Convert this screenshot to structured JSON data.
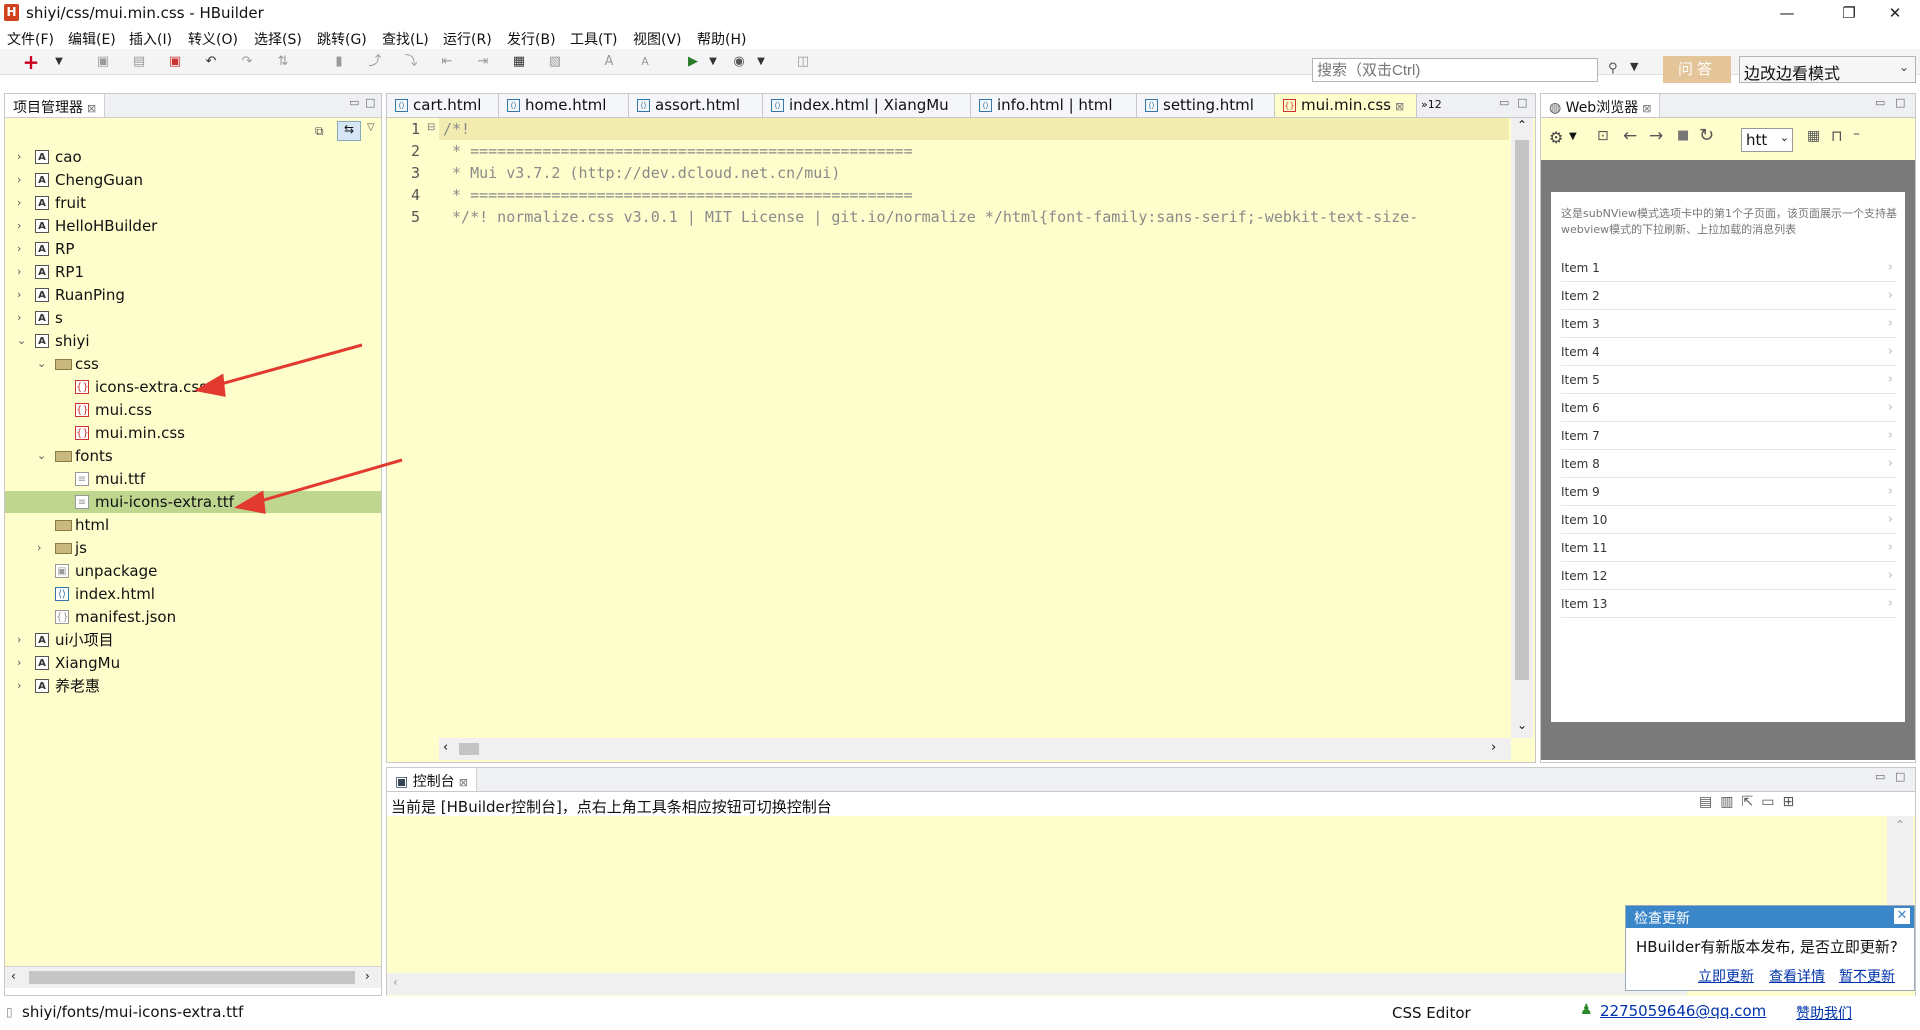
{
  "window": {
    "title": "shiyi/css/mui.min.css  -  HBuilder",
    "logo": "H"
  },
  "menu": [
    "文件(F)",
    "编辑(E)",
    "插入(I)",
    "转义(O)",
    "选择(S)",
    "跳转(G)",
    "查找(L)",
    "运行(R)",
    "发行(B)",
    "工具(T)",
    "视图(V)",
    "帮助(H)"
  ],
  "toolbar": {
    "search_placeholder": "搜索（双击Ctrl)",
    "ask_label": "问答",
    "mode_label": "边改边看模式"
  },
  "project": {
    "title": "项目管理器",
    "tree": [
      {
        "label": "cao",
        "depth": 0,
        "icon": "project-icon",
        "twisty": "›"
      },
      {
        "label": "ChengGuan",
        "depth": 0,
        "icon": "project-icon",
        "twisty": "›"
      },
      {
        "label": "fruit",
        "depth": 0,
        "icon": "project-icon",
        "twisty": "›"
      },
      {
        "label": "HelloHBuilder",
        "depth": 0,
        "icon": "project-icon",
        "twisty": "›"
      },
      {
        "label": "RP",
        "depth": 0,
        "icon": "project-icon",
        "twisty": "›"
      },
      {
        "label": "RP1",
        "depth": 0,
        "icon": "project-icon",
        "twisty": "›"
      },
      {
        "label": "RuanPing",
        "depth": 0,
        "icon": "project-icon",
        "twisty": "›"
      },
      {
        "label": "s",
        "depth": 0,
        "icon": "project-icon",
        "twisty": "›"
      },
      {
        "label": "shiyi",
        "depth": 0,
        "icon": "project-icon",
        "twisty": "⌄"
      },
      {
        "label": "css",
        "depth": 1,
        "icon": "folder-icon",
        "twisty": "⌄"
      },
      {
        "label": "icons-extra.css",
        "depth": 2,
        "icon": "css-file-icon",
        "twisty": ""
      },
      {
        "label": "mui.css",
        "depth": 2,
        "icon": "css-file-icon",
        "twisty": ""
      },
      {
        "label": "mui.min.css",
        "depth": 2,
        "icon": "css-file-icon",
        "twisty": ""
      },
      {
        "label": "fonts",
        "depth": 1,
        "icon": "folder-icon",
        "twisty": "⌄"
      },
      {
        "label": "mui.ttf",
        "depth": 2,
        "icon": "file-icon",
        "twisty": ""
      },
      {
        "label": "mui-icons-extra.ttf",
        "depth": 2,
        "icon": "file-icon",
        "twisty": "",
        "selected": true
      },
      {
        "label": "html",
        "depth": 1,
        "icon": "folder-icon",
        "twisty": ""
      },
      {
        "label": "js",
        "depth": 1,
        "icon": "folder-icon",
        "twisty": "›"
      },
      {
        "label": "unpackage",
        "depth": 1,
        "icon": "package-icon",
        "twisty": ""
      },
      {
        "label": "index.html",
        "depth": 1,
        "icon": "html-file-icon",
        "twisty": ""
      },
      {
        "label": "manifest.json",
        "depth": 1,
        "icon": "json-file-icon",
        "twisty": ""
      },
      {
        "label": "ui小项目",
        "depth": 0,
        "icon": "project-icon",
        "twisty": "›"
      },
      {
        "label": "XiangMu",
        "depth": 0,
        "icon": "project-icon",
        "twisty": "›"
      },
      {
        "label": "养老惠",
        "depth": 0,
        "icon": "project-icon",
        "twisty": "›"
      }
    ]
  },
  "editor": {
    "tabs": [
      "cart.html",
      "home.html",
      "assort.html",
      "index.html | XiangMu",
      "info.html | html",
      "setting.html",
      "mui.min.css"
    ],
    "overflow": "»12",
    "line_numbers": [
      "1",
      "2",
      "3",
      "4",
      "5"
    ],
    "lines": [
      "/*!",
      " * =================================================",
      " * Mui v3.7.2 (http://dev.dcloud.net.cn/mui)",
      " * =================================================",
      " */*! normalize.css v3.0.1 | MIT License | git.io/normalize */html{font-family:sans-serif;-webkit-text-size-"
    ]
  },
  "browser": {
    "title": "Web浏览器",
    "address": "htt",
    "intro": "这是subNView模式选项卡中的第1个子页面，该页面展示一个支持基webview模式的下拉刷新、上拉加载的消息列表",
    "items": [
      "Item 1",
      "Item 2",
      "Item 3",
      "Item 4",
      "Item 5",
      "Item 6",
      "Item 7",
      "Item 8",
      "Item 9",
      "Item 10",
      "Item 11",
      "Item 12",
      "Item 13"
    ]
  },
  "console": {
    "title": "控制台",
    "message": "当前是 [HBuilder控制台]，点右上角工具条相应按钮可切换控制台"
  },
  "status": {
    "path": "shiyi/fonts/mui-icons-extra.ttf",
    "editor": "CSS Editor",
    "user": "2275059646@qq.com",
    "sponsor": "赞助我们"
  },
  "popup": {
    "title": "检查更新",
    "message": "HBuilder有新版本发布, 是否立即更新?",
    "links": [
      "立即更新",
      "查看详情",
      "暂不更新"
    ]
  },
  "colors": {
    "editor_bg": "#fefdcc",
    "selection": "#bfd68f",
    "popup_header": "#3a86c8",
    "arrow": "#e23a2e",
    "ask_button": "#e4c499"
  }
}
